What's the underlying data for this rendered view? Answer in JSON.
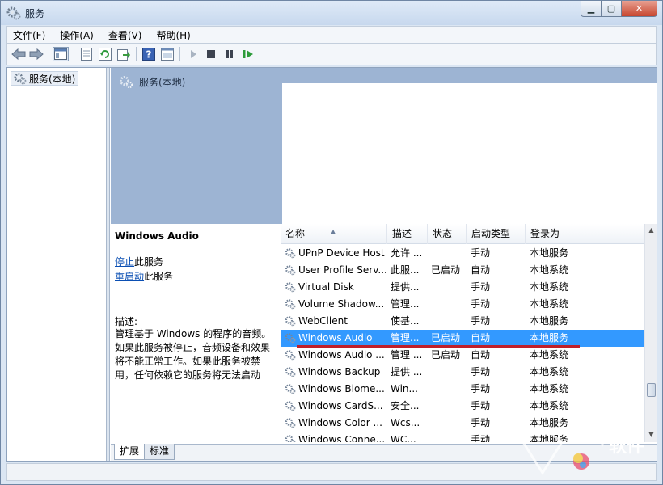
{
  "window": {
    "title": "服务"
  },
  "menu": [
    "文件(F)",
    "操作(A)",
    "查看(V)",
    "帮助(H)"
  ],
  "toolbar_icons": [
    "back-arrow-icon",
    "forward-arrow-icon",
    "console-tree-icon",
    "properties-icon",
    "refresh-icon",
    "export-list-icon",
    "help-icon",
    "mmc-view-icon",
    "start-service-icon",
    "stop-service-icon",
    "pause-service-icon",
    "restart-service-icon"
  ],
  "tree": {
    "node_label": "服务(本地)"
  },
  "header": {
    "title": "服务(本地)",
    "background_color": "#9db4d3"
  },
  "description": {
    "service_name": "Windows Audio",
    "stop_link": "停止",
    "stop_suffix": "此服务",
    "restart_link": "重启动",
    "restart_suffix": "此服务",
    "label": "描述:",
    "text": "管理基于 Windows 的程序的音频。如果此服务被停止，音频设备和效果将不能正常工作。如果此服务被禁用，任何依赖它的服务将无法启动"
  },
  "columns": [
    "名称",
    "描述",
    "状态",
    "启动类型",
    "登录为"
  ],
  "services": [
    {
      "name": "UPnP Device Host",
      "desc": "允许 ...",
      "status": "",
      "startup": "手动",
      "logon": "本地服务"
    },
    {
      "name": "User Profile Serv...",
      "desc": "此服...",
      "status": "已启动",
      "startup": "自动",
      "logon": "本地系统"
    },
    {
      "name": "Virtual Disk",
      "desc": "提供...",
      "status": "",
      "startup": "手动",
      "logon": "本地系统"
    },
    {
      "name": "Volume Shadow...",
      "desc": "管理...",
      "status": "",
      "startup": "手动",
      "logon": "本地系统"
    },
    {
      "name": "WebClient",
      "desc": "使基...",
      "status": "",
      "startup": "手动",
      "logon": "本地服务"
    },
    {
      "name": "Windows Audio",
      "desc": "管理...",
      "status": "已启动",
      "startup": "自动",
      "logon": "本地服务"
    },
    {
      "name": "Windows Audio ...",
      "desc": "管理 ...",
      "status": "已启动",
      "startup": "自动",
      "logon": "本地系统"
    },
    {
      "name": "Windows Backup",
      "desc": "提供 ...",
      "status": "",
      "startup": "手动",
      "logon": "本地系统"
    },
    {
      "name": "Windows Biome...",
      "desc": "Win...",
      "status": "",
      "startup": "手动",
      "logon": "本地系统"
    },
    {
      "name": "Windows CardS...",
      "desc": "安全...",
      "status": "",
      "startup": "手动",
      "logon": "本地系统"
    },
    {
      "name": "Windows Color ...",
      "desc": "Wcs...",
      "status": "",
      "startup": "手动",
      "logon": "本地服务"
    },
    {
      "name": "Windows Conne...",
      "desc": "WC...",
      "status": "",
      "startup": "手动",
      "logon": "本地服务"
    }
  ],
  "selected_index": 5,
  "selection_color": "#3399ff",
  "highlight_color": "#c0202a",
  "tabs": [
    "扩展",
    "标准"
  ],
  "watermark": {
    "text": "软件"
  }
}
